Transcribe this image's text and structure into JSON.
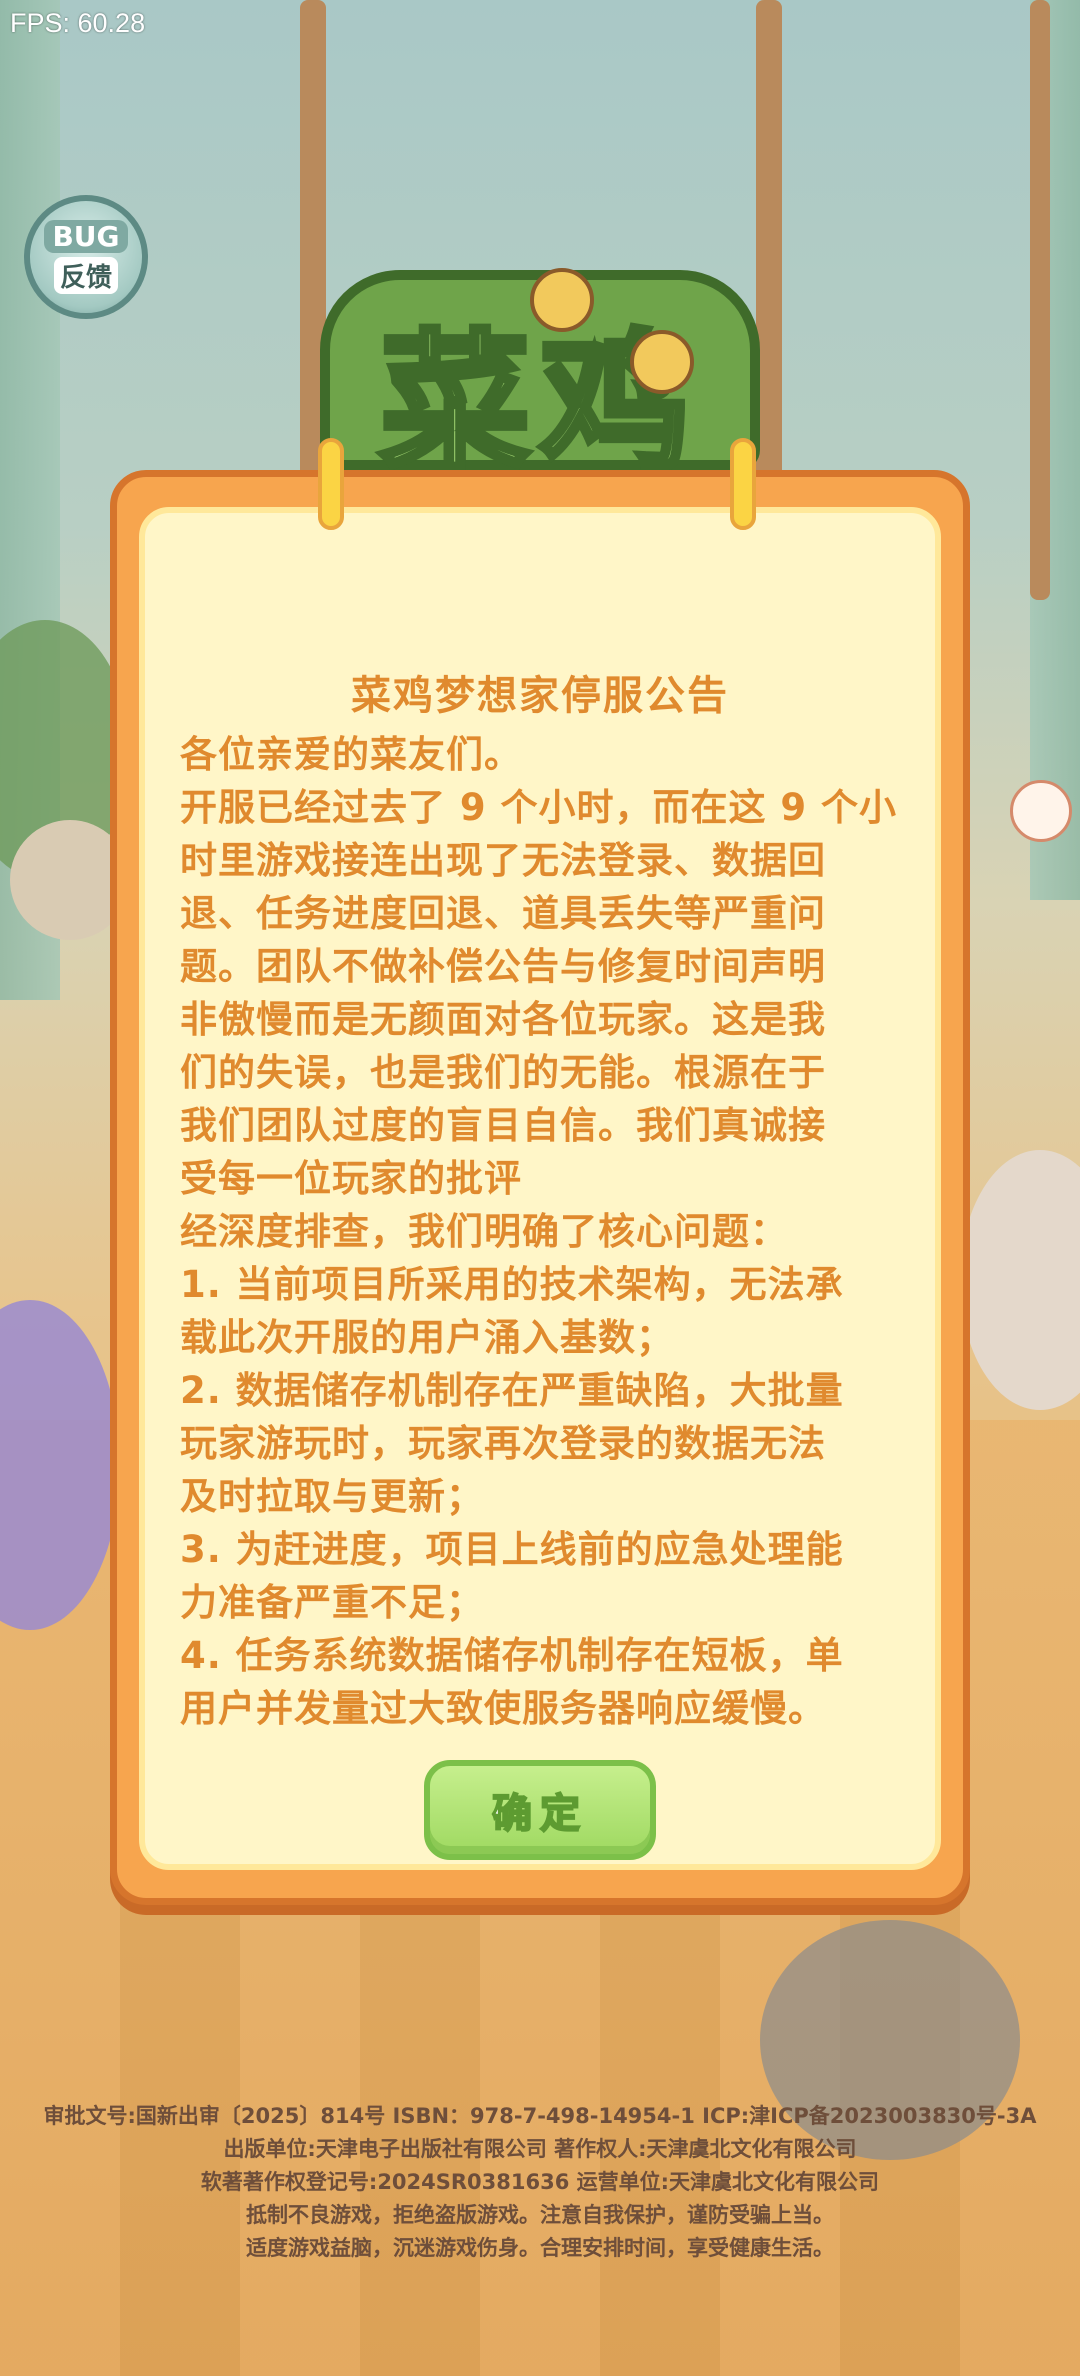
{
  "status_bar": {
    "fps": "FPS: 60.28"
  },
  "feedback_button": {
    "icon_text": "BUG",
    "label": "反馈"
  },
  "logo": {
    "text": "菜鸡"
  },
  "notice": {
    "title": "菜鸡梦想家停服公告",
    "lines": [
      "各位亲爱的菜友们。",
      "开服已经过去了 9 个小时，而在这 9 个小",
      "时里游戏接连出现了无法登录、数据回",
      "退、任务进度回退、道具丢失等严重问",
      "题。团队不做补偿公告与修复时间声明",
      "非傲慢而是无颜面对各位玩家。这是我",
      "们的失误，也是我们的无能。根源在于",
      "我们团队过度的盲目自信。我们真诚接",
      "受每一位玩家的批评",
      "经深度排查，我们明确了核心问题：",
      "1. 当前项目所采用的技术架构，无法承",
      "载此次开服的用户涌入基数；",
      "2. 数据储存机制存在严重缺陷，大批量",
      "玩家游玩时，玩家再次登录的数据无法",
      "及时拉取与更新；",
      "3. 为赶进度，项目上线前的应急处理能",
      "力准备严重不足；",
      "4. 任务系统数据储存机制存在短板，单",
      "用户并发量过大致使服务器响应缓慢。"
    ],
    "confirm_label": "确定"
  },
  "footer": {
    "lines": [
      "审批文号:国新出审〔2025〕814号   ISBN：978-7-498-14954-1  ICP:津ICP备2023003830号-3A",
      "出版单位:天津电子出版社有限公司  著作权人:天津虞北文化有限公司",
      "软著著作权登记号:2024SR0381636  运营单位:天津虞北文化有限公司",
      "抵制不良游戏，拒绝盗版游戏。注意自我保护，谨防受骗上当。",
      "适度游戏益脑，沉迷游戏伤身。合理安排时间，享受健康生活。"
    ]
  },
  "colors": {
    "board_orange": "#f7a54e",
    "paper": "#fff6c8",
    "text_orange": "#e08a2e",
    "button_green": "#9fd961"
  }
}
